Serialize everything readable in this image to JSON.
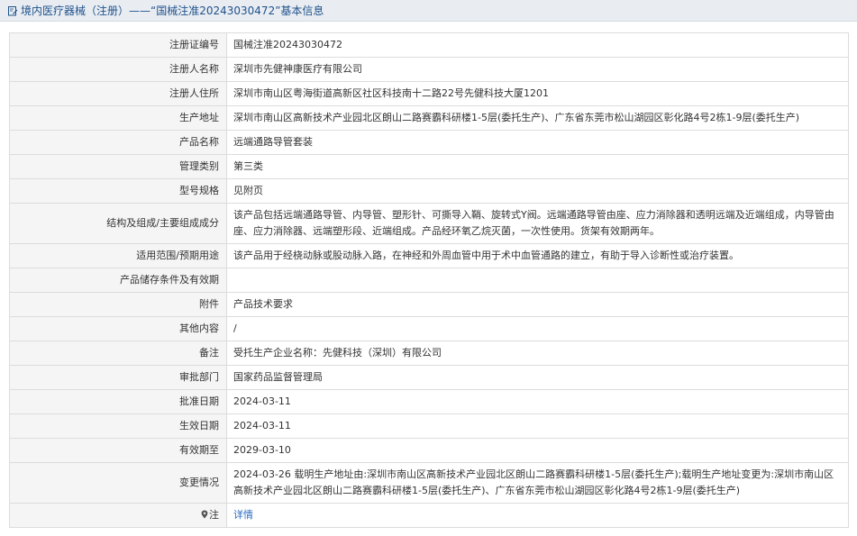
{
  "header": {
    "title": "境内医疗器械（注册）——“国械注准20243030472”基本信息",
    "icon": "document-edit-icon",
    "title_color": "#20528c"
  },
  "rows": [
    {
      "label": "注册证编号",
      "value": "国械注准20243030472"
    },
    {
      "label": "注册人名称",
      "value": "深圳市先健神康医疗有限公司"
    },
    {
      "label": "注册人住所",
      "value": "深圳市南山区粤海街道高新区社区科技南十二路22号先健科技大厦1201"
    },
    {
      "label": "生产地址",
      "value": "深圳市南山区高新技术产业园北区朗山二路赛霸科研楼1-5层(委托生产)、广东省东莞市松山湖园区彰化路4号2栋1-9层(委托生产)"
    },
    {
      "label": "产品名称",
      "value": "远端通路导管套装"
    },
    {
      "label": "管理类别",
      "value": "第三类"
    },
    {
      "label": "型号规格",
      "value": "见附页"
    },
    {
      "label": "结构及组成/主要组成成分",
      "value": "该产品包括远端通路导管、内导管、塑形针、可撕导入鞘、旋转式Y阀。远端通路导管由座、应力消除器和透明远端及近端组成，内导管由座、应力消除器、远端塑形段、近端组成。产品经环氧乙烷灭菌，一次性使用。货架有效期两年。"
    },
    {
      "label": "适用范围/预期用途",
      "value": "该产品用于经桡动脉或股动脉入路，在神经和外周血管中用于术中血管通路的建立，有助于导入诊断性或治疗装置。"
    },
    {
      "label": "产品储存条件及有效期",
      "value": ""
    },
    {
      "label": "附件",
      "value": "产品技术要求"
    },
    {
      "label": "其他内容",
      "value": "/"
    },
    {
      "label": "备注",
      "value": "受托生产企业名称：先健科技（深圳）有限公司"
    },
    {
      "label": "审批部门",
      "value": "国家药品监督管理局"
    },
    {
      "label": "批准日期",
      "value": "2024-03-11"
    },
    {
      "label": "生效日期",
      "value": "2024-03-11"
    },
    {
      "label": "有效期至",
      "value": "2029-03-10"
    },
    {
      "label": "变更情况",
      "value": "2024-03-26 载明生产地址由:深圳市南山区高新技术产业园北区朗山二路赛霸科研楼1-5层(委托生产);载明生产地址变更为:深圳市南山区高新技术产业园北区朗山二路赛霸科研楼1-5层(委托生产)、广东省东莞市松山湖园区彰化路4号2栋1-9层(委托生产)"
    }
  ],
  "note_row": {
    "label": "注",
    "icon": "location-pin-icon",
    "link_text": "详情",
    "link_color": "#2a6ac0"
  }
}
